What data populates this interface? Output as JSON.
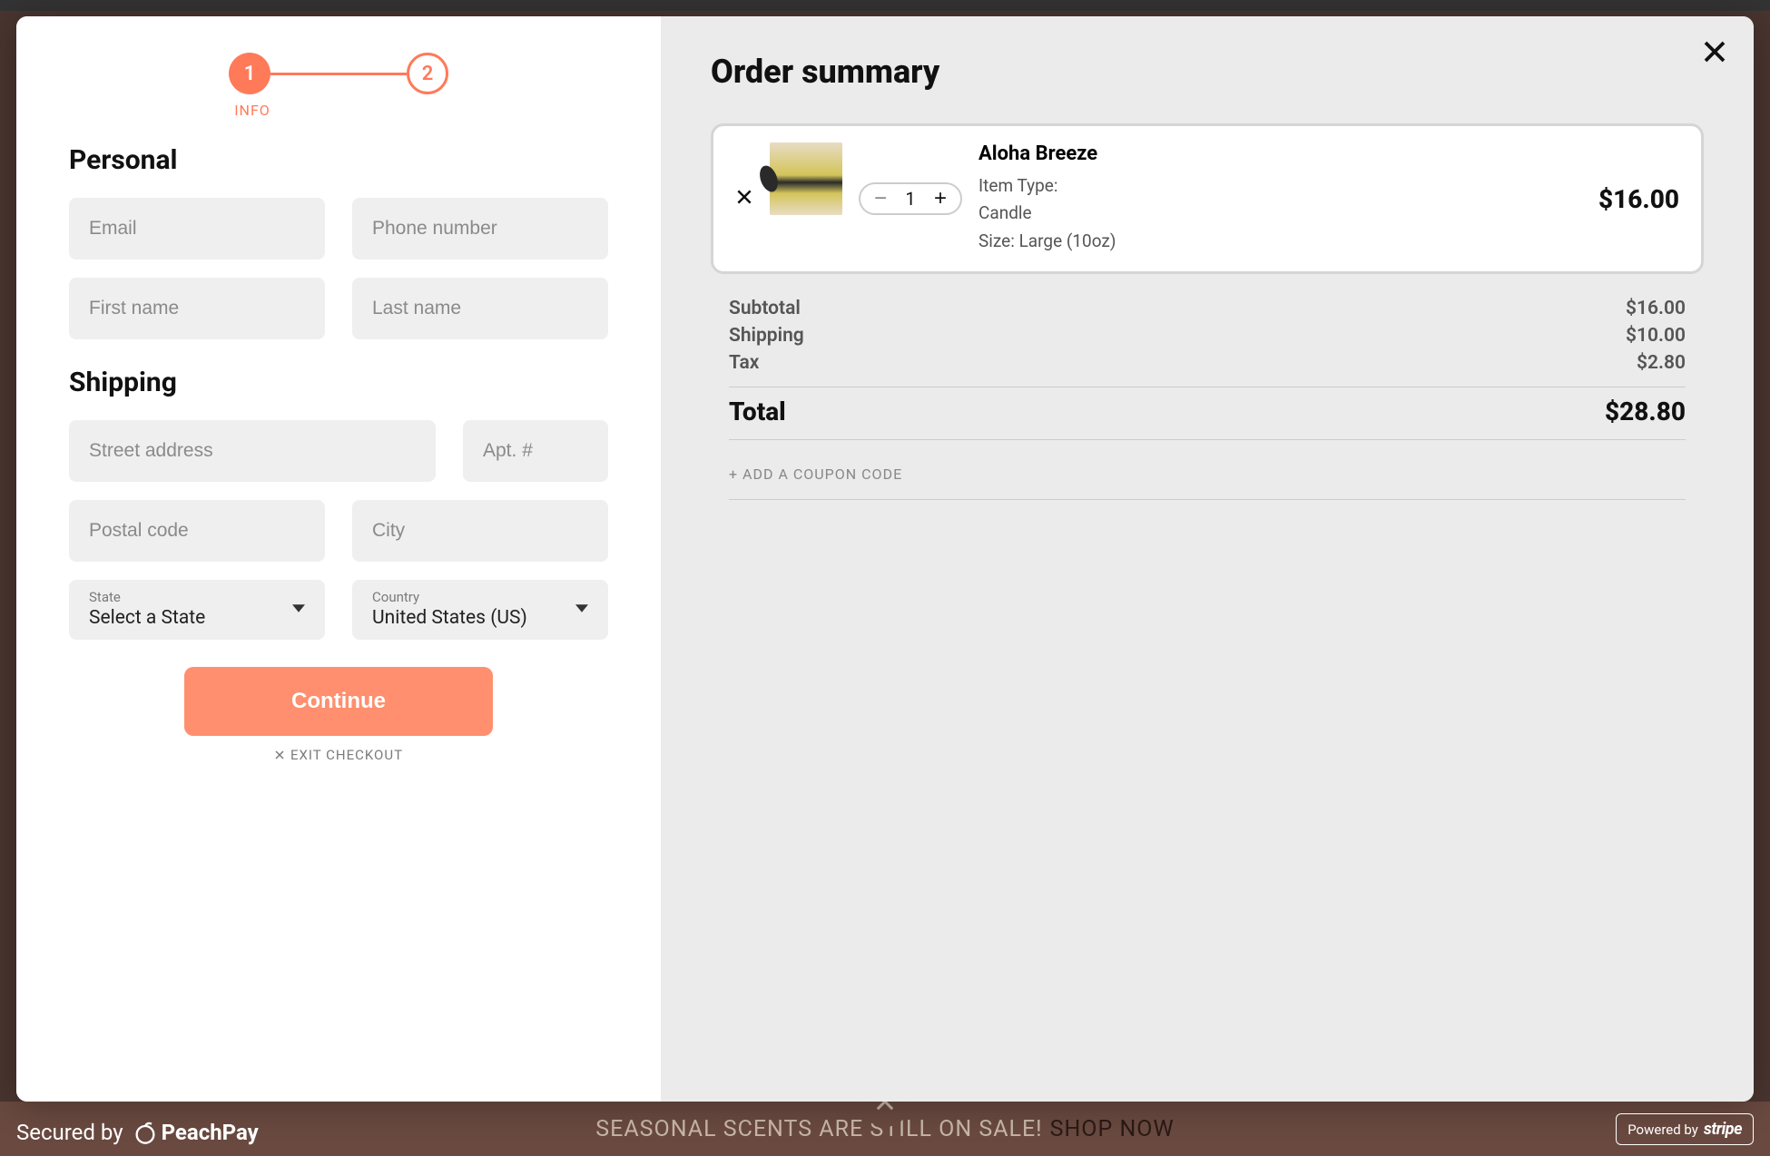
{
  "stepper": {
    "step1": "1",
    "step2": "2",
    "label": "INFO"
  },
  "personal": {
    "heading": "Personal",
    "email_ph": "Email",
    "phone_ph": "Phone number",
    "first_ph": "First name",
    "last_ph": "Last name"
  },
  "shipping": {
    "heading": "Shipping",
    "street_ph": "Street address",
    "apt_ph": "Apt. #",
    "postal_ph": "Postal code",
    "city_ph": "City",
    "state_label": "State",
    "state_value": "Select a State",
    "country_label": "Country",
    "country_value": "United States (US)"
  },
  "actions": {
    "continue": "Continue",
    "exit": "EXIT CHECKOUT"
  },
  "summary": {
    "heading": "Order summary",
    "item": {
      "name": "Aloha Breeze",
      "type_label": "Item Type:",
      "type_value": "Candle",
      "size": "Size: Large (10oz)",
      "qty": "1",
      "price": "$16.00"
    },
    "subtotal_label": "Subtotal",
    "subtotal": "$16.00",
    "shipping_label": "Shipping",
    "shipping": "$10.00",
    "tax_label": "Tax",
    "tax": "$2.80",
    "total_label": "Total",
    "total": "$28.80",
    "coupon": "+ ADD A COUPON CODE"
  },
  "banner": {
    "sale": "SEASONAL SCENTS ARE STILL ON SALE!",
    "shop": "SHOP NOW"
  },
  "footer": {
    "secured": "Secured by",
    "peachpay": "PeachPay",
    "powered": "Powered by",
    "stripe": "stripe"
  }
}
